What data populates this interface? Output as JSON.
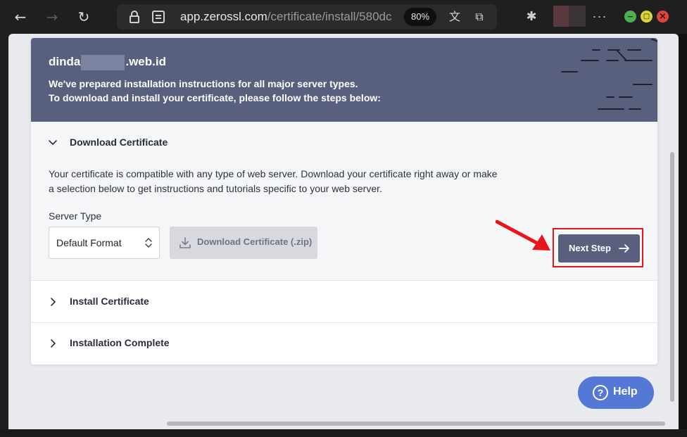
{
  "browser": {
    "url_host": "app.zerossl.com",
    "url_path": "/certificate/install/580dc",
    "zoom": "80%",
    "icons": {
      "back": "back-arrow-icon",
      "forward": "forward-arrow-icon",
      "reload": "reload-icon",
      "lock": "lock-icon",
      "site_settings": "site-settings-icon",
      "translate": "translate-icon",
      "bookmark": "bookmark-icon",
      "extensions": "puzzle-icon",
      "more": "more-icon"
    }
  },
  "header": {
    "domain_prefix": "dinda",
    "domain_suffix": ".web.id",
    "line1": "We've prepared installation instructions for all major server types.",
    "line2": "To download and install your certificate, please follow the steps below:",
    "background_color": "#58607e"
  },
  "steps": {
    "download": {
      "title": "Download Certificate",
      "description": "Your certificate is compatible with any type of web server. Download your certificate right away or make a selection below to get instructions and tutorials specific to your web server.",
      "server_type_label": "Server Type",
      "server_type_value": "Default Format",
      "download_button": "Download Certificate (.zip)",
      "next_button": "Next Step"
    },
    "install": {
      "title": "Install Certificate"
    },
    "complete": {
      "title": "Installation Complete"
    }
  },
  "help": {
    "label": "Help",
    "icon_glyph": "?",
    "color": "#5378d6"
  },
  "annotation": {
    "color": "#e8141a"
  }
}
